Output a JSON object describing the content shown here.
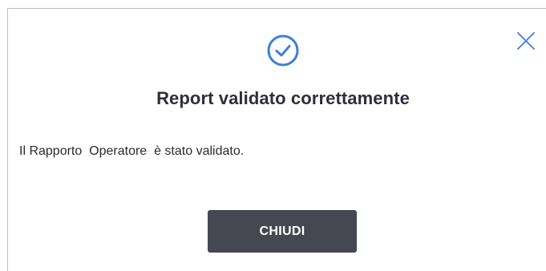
{
  "dialog": {
    "title": "Report validato correttamente",
    "message": "Il Rapporto  Operatore  è stato validato.",
    "close_button_label": "CHIUDI",
    "status_icon": "check-circle-icon",
    "dismiss_icon": "close-icon"
  },
  "colors": {
    "accent": "#3d7fd9",
    "button_bg": "#454751",
    "title_text": "#2e2f3a"
  }
}
